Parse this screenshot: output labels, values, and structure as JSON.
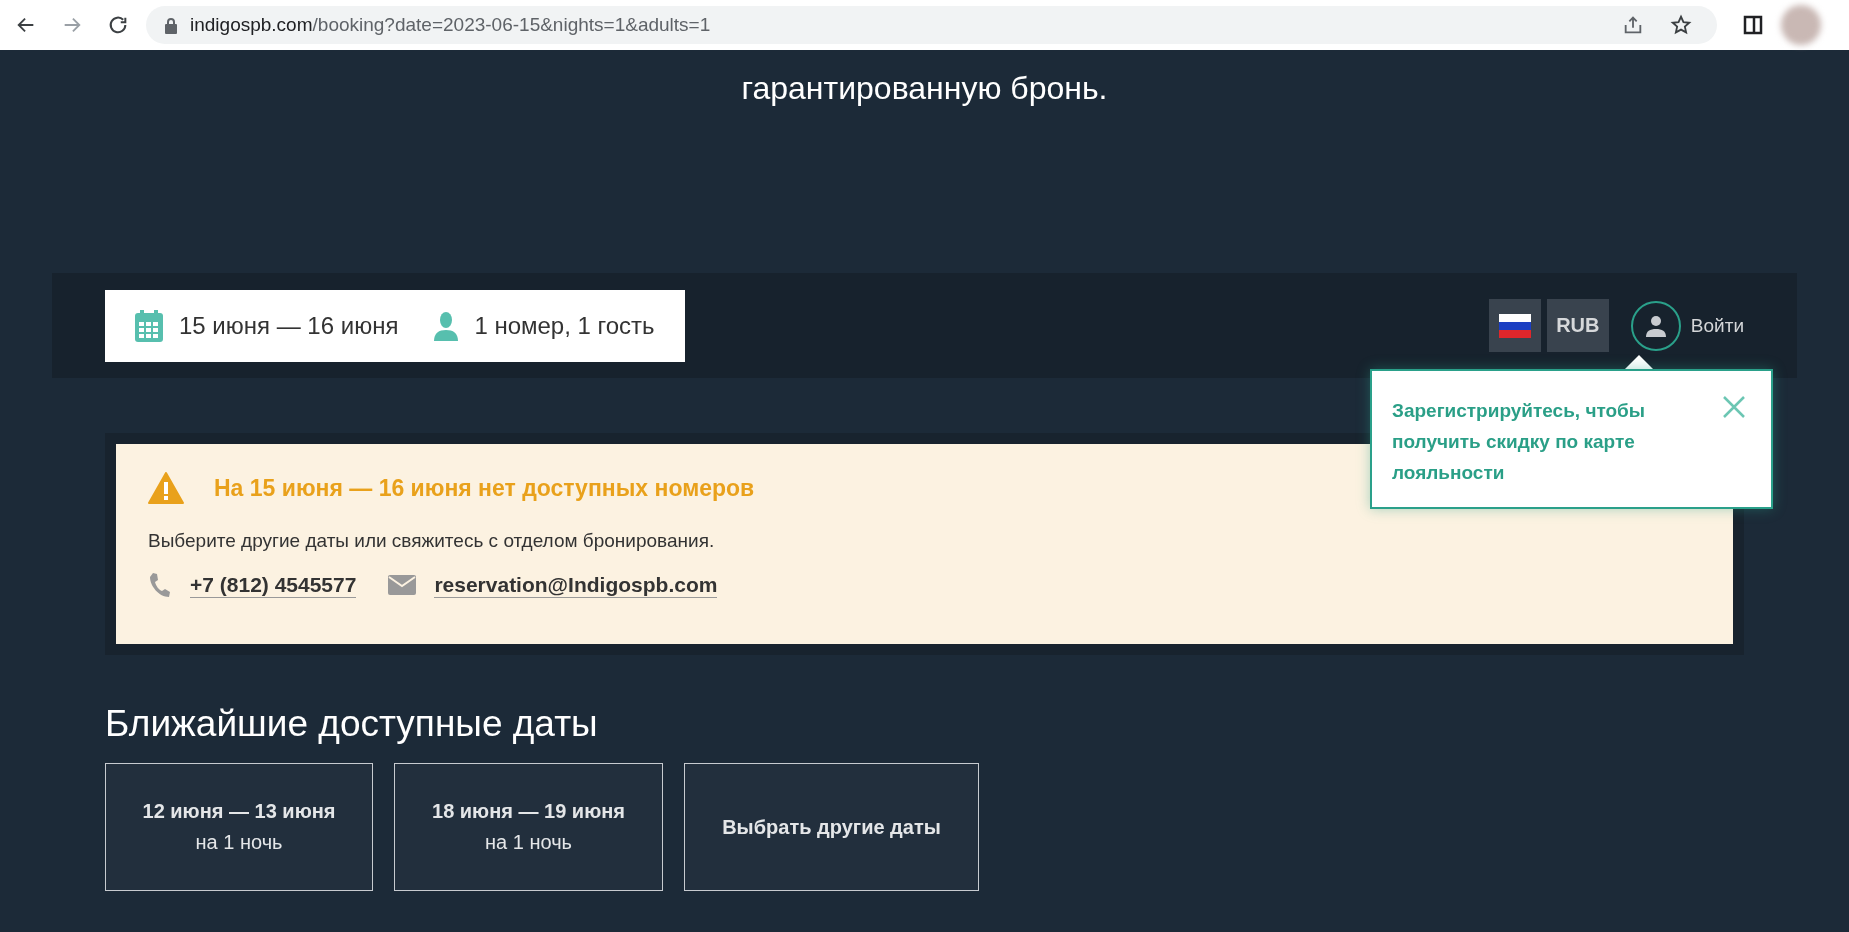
{
  "browser": {
    "url_host": "indigospb.com",
    "url_path": "/booking?date=2023-06-15&nights=1&adults=1",
    "forward_disabled": true
  },
  "intro": {
    "text": "гарантированную бронь."
  },
  "search_bar": {
    "dates": "15 июня — 16 июня",
    "guests": "1 номер, 1 гость",
    "currency": "RUB",
    "login": "Войти"
  },
  "tooltip": {
    "text": "Зарегистрируйтесь, чтобы получить скидку по карте лояльности"
  },
  "alert": {
    "title": "На 15 июня — 16 июня нет доступных номеров",
    "message": "Выберите другие даты или свяжитесь с отделом бронирования.",
    "phone": "+7 (812) 4545577",
    "email": "reservation@Indigospb.com"
  },
  "nearest": {
    "heading": "Ближайшие доступные даты",
    "options": [
      {
        "kind": "dates",
        "dates": "12 июня — 13 июня",
        "nights": "на 1 ночь"
      },
      {
        "kind": "dates",
        "dates": "18 июня — 19 июня",
        "nights": "на 1 ночь"
      },
      {
        "kind": "other",
        "label": "Выбрать другие даты"
      }
    ]
  }
}
